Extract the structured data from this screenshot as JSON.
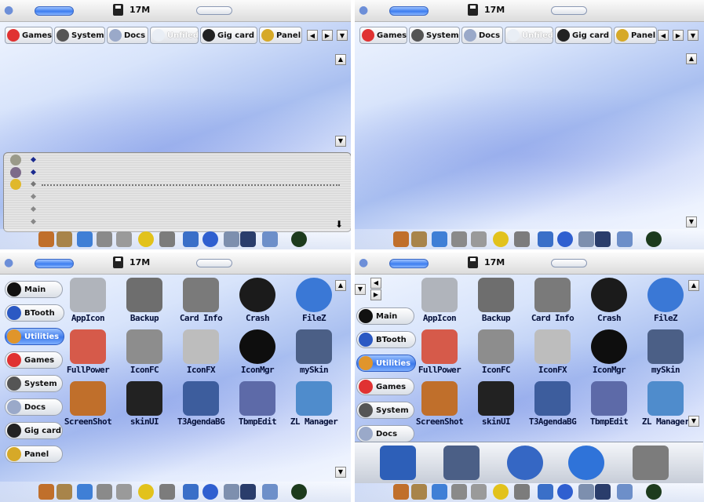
{
  "topbar": {
    "memory": "17M"
  },
  "tabs": [
    {
      "label": "Games",
      "icon": "games-icon",
      "color": "#e03232"
    },
    {
      "label": "System",
      "icon": "system-icon",
      "color": "#555555"
    },
    {
      "label": "Docs",
      "icon": "docs-icon",
      "color": "#9aa9c9"
    },
    {
      "label": "Unfiled",
      "icon": "clock-icon",
      "color": "#e9eef5"
    },
    {
      "label": "Gig card",
      "icon": "sd-card-icon",
      "color": "#222222"
    },
    {
      "label": "Panel",
      "icon": "panel-icon",
      "color": "#d6a928"
    }
  ],
  "sidebar": [
    {
      "label": "Main",
      "icon": "x-icon",
      "color": "#111111"
    },
    {
      "label": "BTooth",
      "icon": "bluetooth-icon",
      "color": "#2b59c3"
    },
    {
      "label": "Utilities",
      "icon": "apple-icon",
      "color": "#e0952b"
    },
    {
      "label": "Games",
      "icon": "games-icon",
      "color": "#e03232"
    },
    {
      "label": "System",
      "icon": "system-icon",
      "color": "#555555"
    },
    {
      "label": "Docs",
      "icon": "docs-icon",
      "color": "#9aa9c9"
    },
    {
      "label": "Gig card",
      "icon": "sd-card-icon",
      "color": "#222222"
    },
    {
      "label": "Panel",
      "icon": "panel-icon",
      "color": "#d6a928"
    }
  ],
  "apps": [
    {
      "label": "AppIcon",
      "icon": "appicon-icon",
      "color": "#b0b4bb"
    },
    {
      "label": "Backup",
      "icon": "floppy-backup-icon",
      "color": "#6e6e6e"
    },
    {
      "label": "Card Info",
      "icon": "floppy-gear-icon",
      "color": "#7a7a7a"
    },
    {
      "label": "Crash",
      "icon": "bomb-icon",
      "color": "#1b1b1b"
    },
    {
      "label": "FileZ",
      "icon": "globe-icon",
      "color": "#3a78d6"
    },
    {
      "label": "FullPower",
      "icon": "battery-icon",
      "color": "#d65a4a"
    },
    {
      "label": "IconFC",
      "icon": "drafting-tools-icon",
      "color": "#8d8d8d"
    },
    {
      "label": "IconFX",
      "icon": "scissors-icon",
      "color": "#bdbdbd"
    },
    {
      "label": "IconMgr",
      "icon": "x-icon",
      "color": "#0e0e0e"
    },
    {
      "label": "mySkin",
      "icon": "coffee-mug-icon",
      "color": "#4b5f86"
    },
    {
      "label": "ScreenShot",
      "icon": "camera-photo-icon",
      "color": "#c06f2b"
    },
    {
      "label": "skinUI",
      "icon": "tuxedo-icon",
      "color": "#222222"
    },
    {
      "label": "T3AgendaBG",
      "icon": "agenda-grid-icon",
      "color": "#3d5d9d"
    },
    {
      "label": "TbmpEdit",
      "icon": "image-editor-icon",
      "color": "#5d6aa8"
    },
    {
      "label": "ZL Manager",
      "icon": "tools-globe-icon",
      "color": "#4f8ccc"
    }
  ],
  "dock_icons": [
    {
      "icon": "screenshot-icon",
      "color": "#c06f2b"
    },
    {
      "icon": "lock-icon",
      "color": "#a8844a"
    },
    {
      "icon": "bluetooth-icon",
      "color": "#3f7fd6"
    },
    {
      "icon": "camera-icon",
      "color": "#8a8a8a"
    },
    {
      "icon": "calculator-icon",
      "color": "#9a9a9a"
    },
    {
      "icon": "radiation-icon",
      "color": "#e2c21c"
    },
    {
      "icon": "trash-icon",
      "color": "#7c7c7c"
    },
    {
      "icon": "network-icon",
      "color": "#3a6fc8"
    },
    {
      "icon": "globe-icon",
      "color": "#2f5fd0"
    },
    {
      "icon": "tools-icon",
      "color": "#7d8fae"
    },
    {
      "icon": "apple-speaker-icon",
      "color": "#2a3d6b"
    },
    {
      "icon": "satellite-icon",
      "color": "#6d8fc9"
    },
    {
      "icon": "sphere-icon",
      "color": "#1d3b1d"
    }
  ],
  "big_dock": [
    {
      "icon": "agenda-book-icon",
      "color": "#2d5fb8"
    },
    {
      "icon": "coffee-mug-icon",
      "color": "#4b5f86"
    },
    {
      "icon": "network-globe-icon",
      "color": "#3567c4"
    },
    {
      "icon": "info-icon",
      "color": "#2f73d9"
    },
    {
      "icon": "trash-icon",
      "color": "#7c7c7c"
    }
  ],
  "agenda_icons": [
    {
      "icon": "clock-icon",
      "color": "#9a9a8a"
    },
    {
      "icon": "checkbox-icon",
      "color": "#7d6b8a"
    },
    {
      "icon": "todo-check-icon",
      "color": "#e0b82b"
    }
  ]
}
